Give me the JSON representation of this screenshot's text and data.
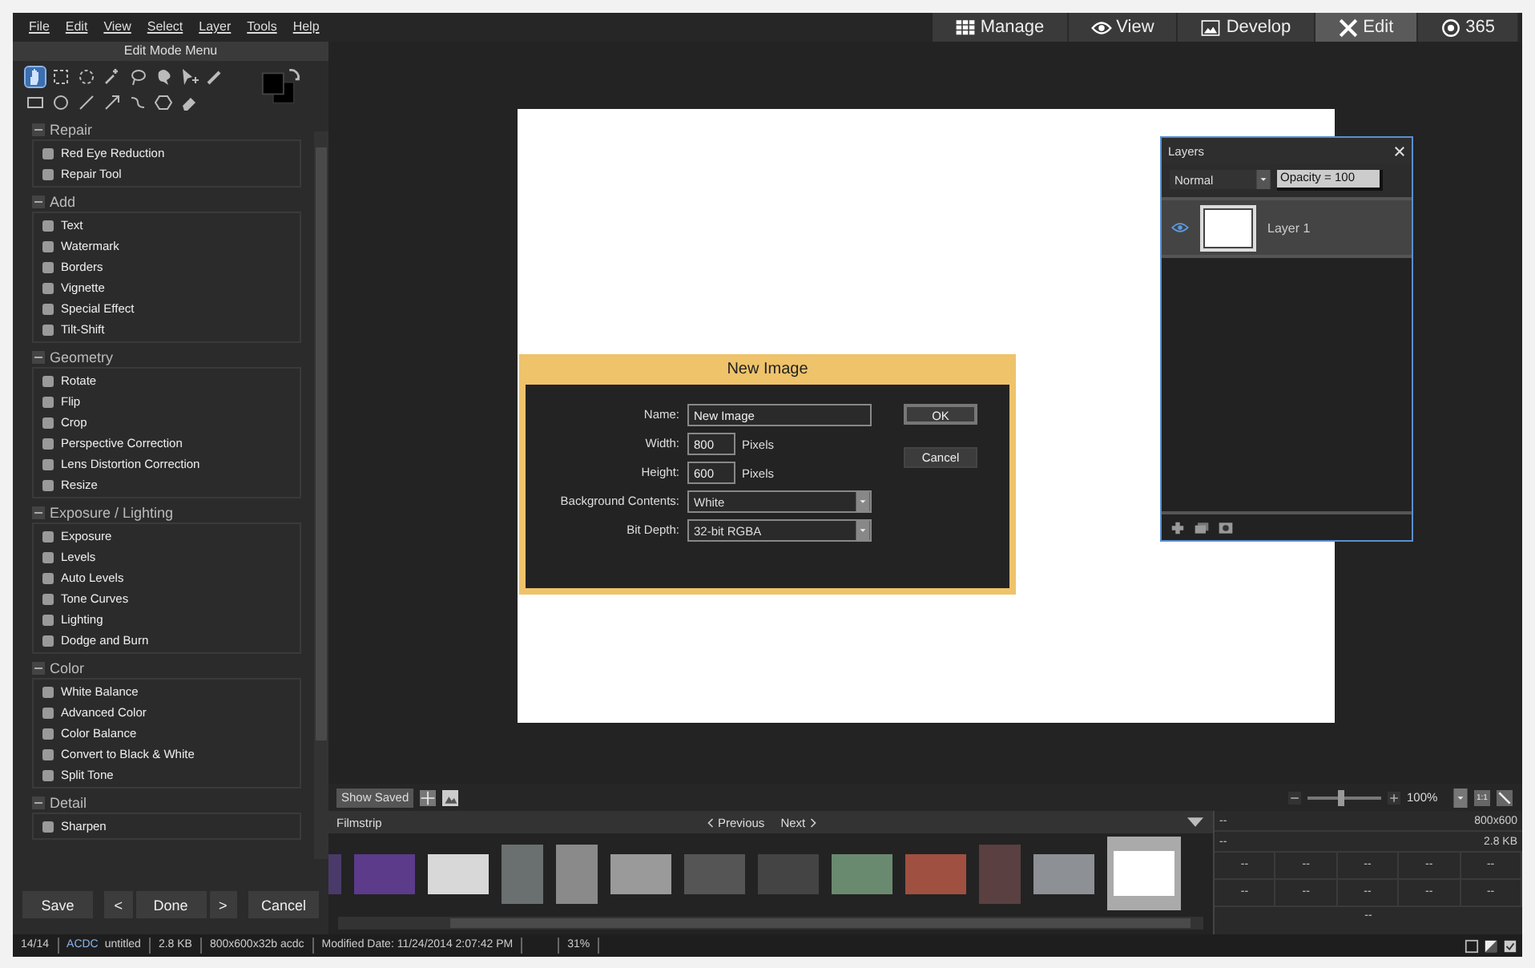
{
  "menu": [
    "File",
    "Edit",
    "View",
    "Select",
    "Layer",
    "Tools",
    "Help"
  ],
  "modes": [
    {
      "label": "Manage",
      "kind": "grid",
      "selected": false
    },
    {
      "label": "View",
      "kind": "eye",
      "selected": false
    },
    {
      "label": "Develop",
      "kind": "picture",
      "selected": false
    },
    {
      "label": "Edit",
      "kind": "tools",
      "selected": true
    },
    {
      "label": "365",
      "kind": "badge",
      "selected": false
    }
  ],
  "edit_panel": {
    "title": "Edit Mode Menu",
    "tools": [
      {
        "kind": "hand",
        "selected": true
      },
      {
        "kind": "dashed-rectangle",
        "selected": false
      },
      {
        "kind": "dashed-circle",
        "selected": false
      },
      {
        "kind": "wand",
        "selected": false
      },
      {
        "kind": "lasso",
        "selected": false
      },
      {
        "kind": "blob",
        "selected": false
      },
      {
        "kind": "cursor",
        "selected": false
      },
      {
        "kind": "pencil",
        "selected": false
      },
      {
        "kind": "rectangle",
        "selected": false
      },
      {
        "kind": "circle",
        "selected": false
      },
      {
        "kind": "line",
        "selected": false
      },
      {
        "kind": "arrow",
        "selected": false
      },
      {
        "kind": "curve",
        "selected": false
      },
      {
        "kind": "hexagon",
        "selected": false
      },
      {
        "kind": "eraser",
        "selected": false
      }
    ],
    "sections": [
      {
        "title": "Repair",
        "expanded": true,
        "items": [
          "Red Eye Reduction",
          "Repair Tool"
        ]
      },
      {
        "title": "Add",
        "expanded": true,
        "items": [
          "Text",
          "Watermark",
          "Borders",
          "Vignette",
          "Special Effect",
          "Tilt-Shift"
        ]
      },
      {
        "title": "Geometry",
        "expanded": true,
        "items": [
          "Rotate",
          "Flip",
          "Crop",
          "Perspective Correction",
          "Lens Distortion Correction",
          "Resize"
        ]
      },
      {
        "title": "Exposure / Lighting",
        "expanded": true,
        "items": [
          "Exposure",
          "Levels",
          "Auto Levels",
          "Tone Curves",
          "Lighting",
          "Dodge and Burn"
        ]
      },
      {
        "title": "Color",
        "expanded": true,
        "items": [
          "White Balance",
          "Advanced Color",
          "Color Balance",
          "Convert to Black & White",
          "Split Tone"
        ]
      },
      {
        "title": "Detail",
        "expanded": true,
        "items": [
          "Sharpen"
        ]
      }
    ],
    "buttons": {
      "save": "Save",
      "prev": "<",
      "done": "Done",
      "next": ">",
      "cancel": "Cancel"
    }
  },
  "dialog": {
    "title": "New Image",
    "fields": [
      {
        "label": "Name:",
        "value": "New Image",
        "kind": "text"
      },
      {
        "label": "Width:",
        "value": "800",
        "kind": "number",
        "unit": "Pixels"
      },
      {
        "label": "Height:",
        "value": "600",
        "kind": "number",
        "unit": "Pixels"
      },
      {
        "label": "Background Contents:",
        "value": "White",
        "kind": "select"
      },
      {
        "label": "Bit Depth:",
        "value": "32-bit RGBA",
        "kind": "select"
      }
    ],
    "ok": "OK",
    "cancel": "Cancel"
  },
  "layers": {
    "title": "Layers",
    "blend_mode": "Normal",
    "opacity": "Opacity = 100",
    "items": [
      {
        "name": "Layer 1",
        "visible": true,
        "selected": true
      }
    ]
  },
  "toolbar": {
    "show_saved": "Show Saved",
    "level": 0.45,
    "zoom": "100%",
    "actual_size": "1:1"
  },
  "filmstrip": {
    "title": "Filmstrip",
    "previous": "Previous",
    "next": "Next",
    "thumbs": [
      {
        "kind": "edge",
        "selected": false
      },
      {
        "kind": "landscape",
        "selected": false
      },
      {
        "kind": "landscape",
        "selected": false
      },
      {
        "kind": "portrait",
        "selected": false
      },
      {
        "kind": "portrait",
        "selected": false
      },
      {
        "kind": "landscape",
        "selected": false
      },
      {
        "kind": "landscape",
        "selected": false
      },
      {
        "kind": "landscape",
        "selected": false
      },
      {
        "kind": "landscape",
        "selected": false
      },
      {
        "kind": "landscape",
        "selected": false
      },
      {
        "kind": "portrait",
        "selected": false
      },
      {
        "kind": "landscape",
        "selected": false
      },
      {
        "kind": "landscape",
        "selected": true
      }
    ]
  },
  "info": {
    "rows": [
      {
        "left": "--",
        "right": "800x600"
      },
      {
        "left": "--",
        "right": "2.8 KB"
      }
    ],
    "grid": [
      "--",
      "--",
      "--",
      "--",
      "--",
      "--",
      "--",
      "--",
      "--",
      "--"
    ],
    "footer": "--"
  },
  "status": {
    "count": "14/14",
    "format": "ACDC",
    "name": "untitled",
    "size": "2.8 KB",
    "dimensions": "800x600x32b acdc",
    "modified": "Modified Date: 11/24/2014 2:07:42 PM",
    "zoom": "31%"
  }
}
